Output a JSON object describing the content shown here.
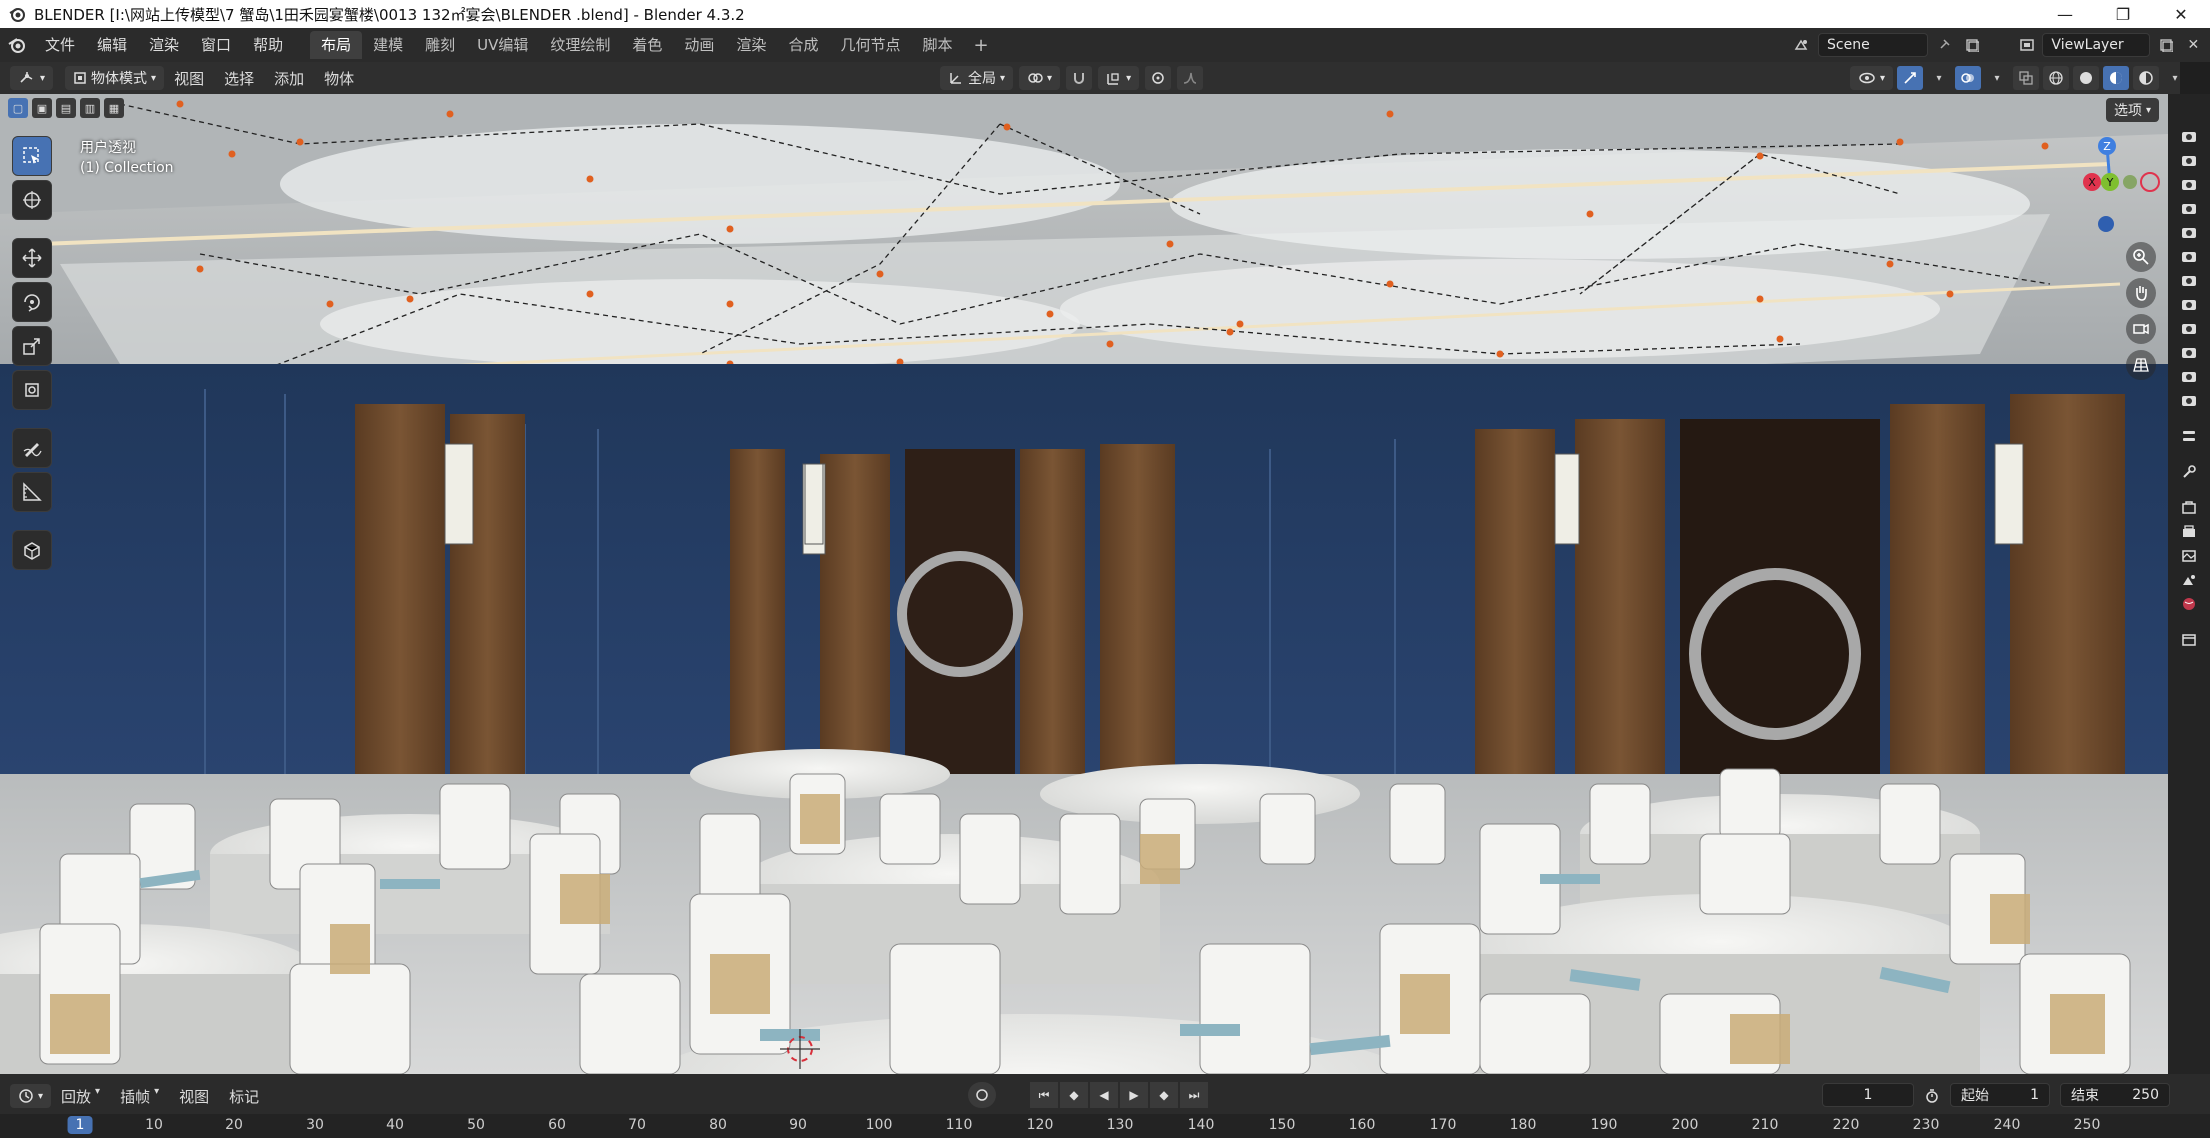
{
  "window": {
    "title": "BLENDER  [I:\\网站上传模型\\7 蟹岛\\1田禾园宴蟹楼\\0013 132㎡宴会\\BLENDER .blend] - Blender 4.3.2",
    "controls": [
      "—",
      "❐",
      "✕"
    ]
  },
  "menubar": {
    "menus": [
      "文件",
      "编辑",
      "渲染",
      "窗口",
      "帮助"
    ],
    "workspaces": [
      "布局",
      "建模",
      "雕刻",
      "UV编辑",
      "纹理绘制",
      "着色",
      "动画",
      "渲染",
      "合成",
      "几何节点",
      "脚本"
    ],
    "active_workspace": "布局",
    "add_workspace": "+",
    "scene_name": "Scene",
    "view_layer": "ViewLayer"
  },
  "viewport_header": {
    "mode": "物体模式",
    "menus": [
      "视图",
      "选择",
      "添加",
      "物体"
    ],
    "transform_orientation": "全局",
    "options_label": "选项"
  },
  "viewport": {
    "view_name": "用户透视",
    "collection": "(1) Collection",
    "gizmo_axes": {
      "z": "Z",
      "y": "Y",
      "x": "X"
    },
    "colors": {
      "x_axis": "#e0334d",
      "y_axis": "#7fbf2f",
      "z_axis": "#3f7fe0",
      "selection_blue": "#4772b3"
    }
  },
  "timeline": {
    "playback_menu": "回放",
    "keying_menu": "插帧",
    "view_menu": "视图",
    "marker_menu": "标记",
    "current_frame": "1",
    "start_label": "起始",
    "start_frame": "1",
    "end_label": "结束",
    "end_frame": "250",
    "ruler_current": "1",
    "ruler_ticks": [
      "10",
      "20",
      "30",
      "40",
      "50",
      "60",
      "70",
      "80",
      "90",
      "100",
      "110",
      "120",
      "130",
      "140",
      "150",
      "160",
      "170",
      "180",
      "190",
      "200",
      "210",
      "220",
      "230",
      "240",
      "250"
    ]
  }
}
